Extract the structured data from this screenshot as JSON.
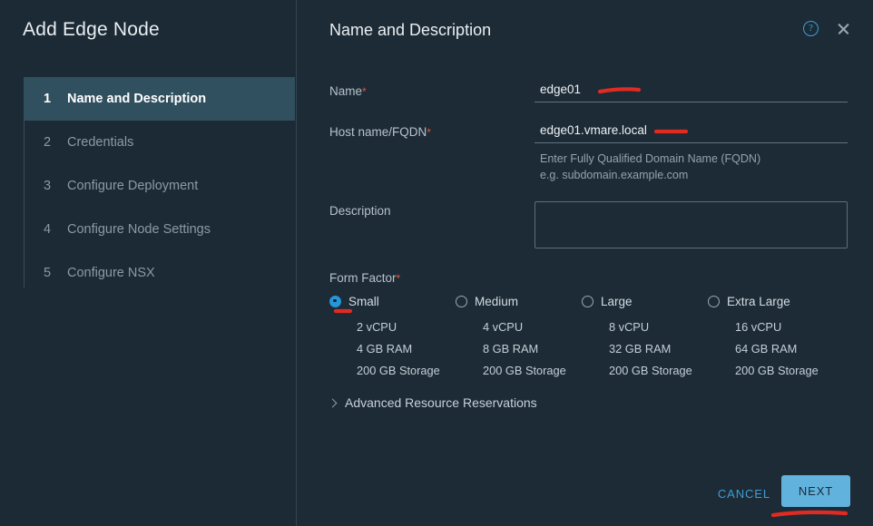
{
  "wizard": {
    "title": "Add Edge Node",
    "steps": [
      {
        "num": "1",
        "label": "Name and Description"
      },
      {
        "num": "2",
        "label": "Credentials"
      },
      {
        "num": "3",
        "label": "Configure Deployment"
      },
      {
        "num": "4",
        "label": "Configure Node Settings"
      },
      {
        "num": "5",
        "label": "Configure NSX"
      }
    ]
  },
  "header": {
    "title": "Name and Description",
    "help_icon": "help-circle-icon",
    "close_icon": "close-icon"
  },
  "form": {
    "name": {
      "label": "Name",
      "required_mark": "*",
      "value": "edge01",
      "placeholder": ""
    },
    "fqdn": {
      "label": "Host name/FQDN",
      "required_mark": "*",
      "value": "edge01.vmare.local",
      "placeholder": "",
      "hint_line1": "Enter Fully Qualified Domain Name (FQDN)",
      "hint_line2": "e.g. subdomain.example.com"
    },
    "description": {
      "label": "Description",
      "value": "",
      "placeholder": ""
    },
    "form_factor": {
      "label": "Form Factor",
      "required_mark": "*",
      "selected": "Small",
      "options": [
        {
          "name": "Small",
          "cpu": "2 vCPU",
          "ram": "4 GB RAM",
          "storage": "200 GB Storage",
          "selected": true
        },
        {
          "name": "Medium",
          "cpu": "4 vCPU",
          "ram": "8 GB RAM",
          "storage": "200 GB Storage",
          "selected": false
        },
        {
          "name": "Large",
          "cpu": "8 vCPU",
          "ram": "32 GB RAM",
          "storage": "200 GB Storage",
          "selected": false
        },
        {
          "name": "Extra Large",
          "cpu": "16 vCPU",
          "ram": "64 GB RAM",
          "storage": "200 GB Storage",
          "selected": false
        }
      ]
    },
    "advanced": {
      "label": "Advanced Resource Reservations",
      "expanded": false,
      "chevron_icon": "chevron-right-icon"
    }
  },
  "footer": {
    "cancel_label": "CANCEL",
    "next_label": "NEXT"
  },
  "colors": {
    "background": "#1b2a35",
    "panel": "#1d2b36",
    "active_step": "#31505f",
    "accent": "#3f9fd4",
    "primary_button": "#61b3de",
    "required": "#e8503a",
    "annotation": "#e02b23"
  }
}
